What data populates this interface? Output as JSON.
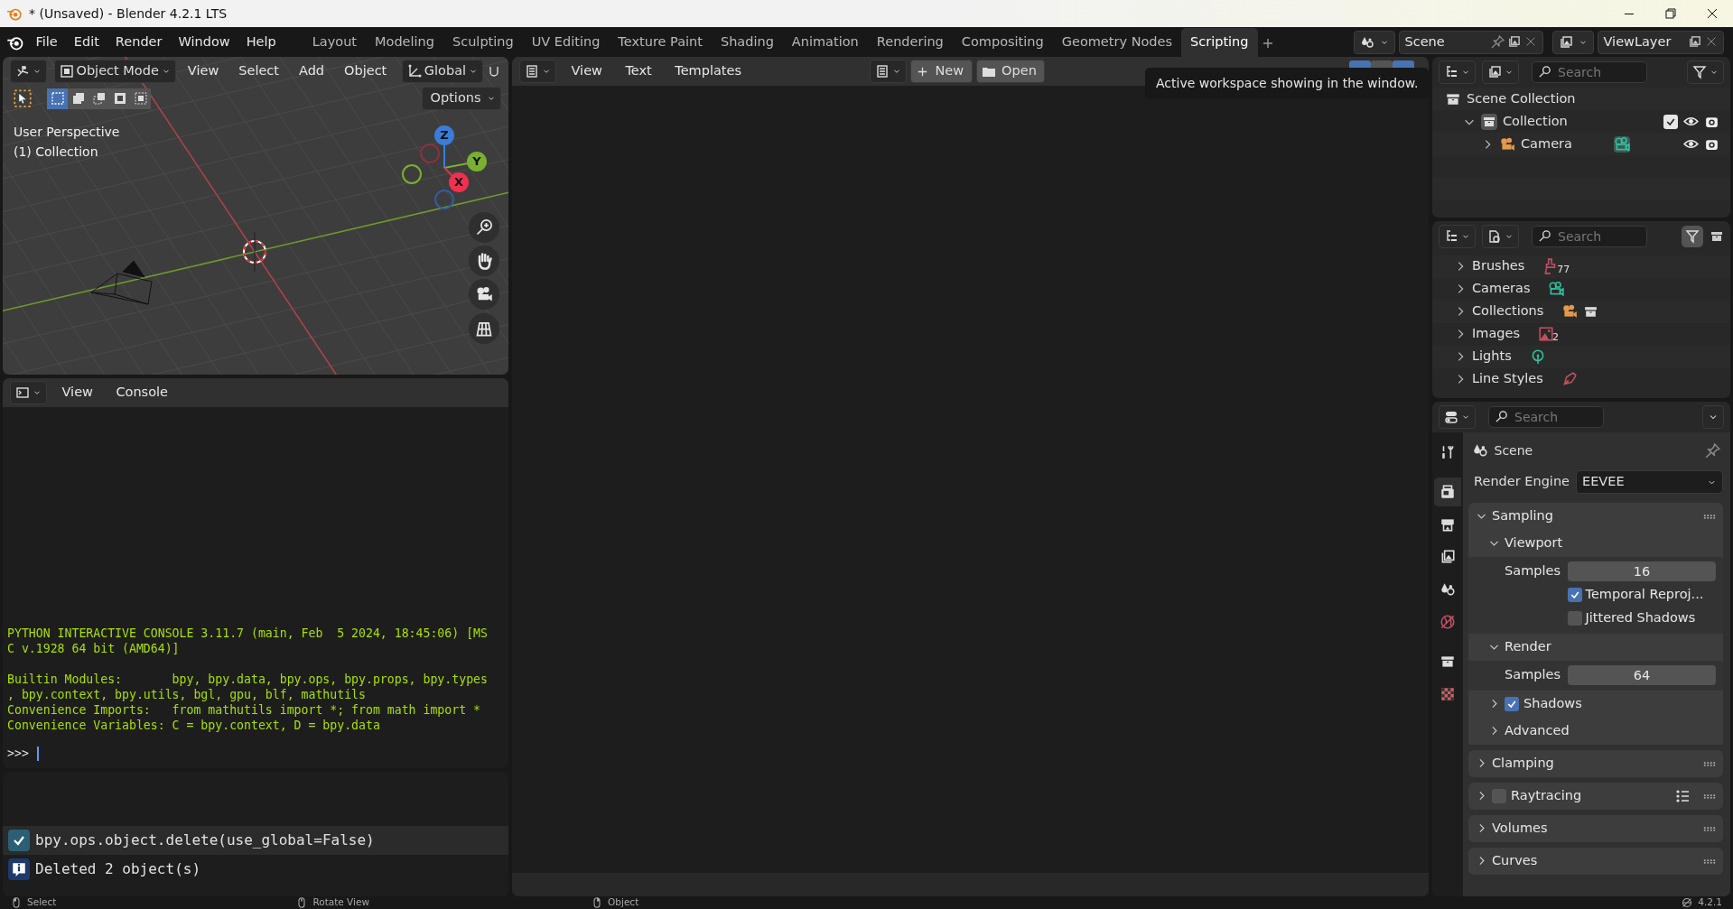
{
  "window": {
    "title": "* (Unsaved) - Blender 4.2.1 LTS"
  },
  "menu": [
    "File",
    "Edit",
    "Render",
    "Window",
    "Help"
  ],
  "workspaces": [
    {
      "label": "Layout",
      "selected": false
    },
    {
      "label": "Modeling",
      "selected": false
    },
    {
      "label": "Sculpting",
      "selected": false
    },
    {
      "label": "UV Editing",
      "selected": false
    },
    {
      "label": "Texture Paint",
      "selected": false
    },
    {
      "label": "Shading",
      "selected": false
    },
    {
      "label": "Animation",
      "selected": false
    },
    {
      "label": "Rendering",
      "selected": false
    },
    {
      "label": "Compositing",
      "selected": false
    },
    {
      "label": "Geometry Nodes",
      "selected": false
    },
    {
      "label": "Scripting",
      "selected": true
    }
  ],
  "scene": {
    "name": "Scene"
  },
  "view_layer": {
    "name": "ViewLayer"
  },
  "viewport": {
    "mode": "Object Mode",
    "menus": [
      "View",
      "Select",
      "Add",
      "Object"
    ],
    "orientation": "Global",
    "options": "Options",
    "select_modes": [
      {
        "kind": "set",
        "selected": true
      },
      {
        "kind": "extend",
        "selected": false
      },
      {
        "kind": "subtract",
        "selected": false
      },
      {
        "kind": "invert",
        "selected": false
      },
      {
        "kind": "intersect",
        "selected": false
      }
    ],
    "overlay_lines": [
      "User Perspective",
      "(1) Collection"
    ],
    "gizmo": {
      "x": "X",
      "y": "Y",
      "z": "Z"
    }
  },
  "text_editor": {
    "menus": [
      "View",
      "Text",
      "Templates"
    ],
    "new": "New",
    "open": "Open",
    "tooltip": "Active workspace showing in the window."
  },
  "console": {
    "menus": [
      "View",
      "Console"
    ],
    "blocks": [
      [
        "PYTHON INTERACTIVE CONSOLE 3.11.7 (main, Feb  5 2024, 18:45:06) [MS",
        "C v.1928 64 bit (AMD64)]"
      ],
      [
        "Builtin Modules:       bpy, bpy.data, bpy.ops, bpy.props, bpy.types",
        ", bpy.context, bpy.utils, bgl, gpu, blf, mathutils",
        "Convenience Imports:   from mathutils import *; from math import *",
        "Convenience Variables: C = bpy.context, D = bpy.data"
      ]
    ],
    "prompt": ">>>"
  },
  "info": {
    "entries": [
      {
        "kind": "operator",
        "text": "bpy.ops.object.delete(use_global=False)"
      },
      {
        "kind": "info",
        "text": "Deleted 2 object(s)"
      }
    ]
  },
  "outliner": {
    "search": {
      "placeholder": "Search"
    },
    "items": [
      {
        "label": "Scene Collection",
        "kind": "scene",
        "children": [
          {
            "label": "Collection",
            "kind": "collection",
            "expanded": true,
            "checked": true,
            "children": [
              {
                "label": "Camera",
                "kind": "camera",
                "expanded": false
              }
            ]
          }
        ]
      }
    ]
  },
  "blend_file": {
    "search": {
      "placeholder": "Search"
    },
    "items": [
      {
        "label": "Brushes",
        "kind": "brush",
        "count": "77"
      },
      {
        "label": "Cameras",
        "kind": "camera"
      },
      {
        "label": "Collections",
        "kind": "collection"
      },
      {
        "label": "Images",
        "kind": "image",
        "count": "2"
      },
      {
        "label": "Lights",
        "kind": "light"
      },
      {
        "label": "Line Styles",
        "kind": "linestyle"
      }
    ]
  },
  "properties": {
    "search": {
      "placeholder": "Search"
    },
    "tabs": [
      {
        "kind": "tool",
        "selected": false
      },
      {
        "kind": "render",
        "selected": true
      },
      {
        "kind": "output",
        "selected": false
      },
      {
        "kind": "viewlayer",
        "selected": false
      },
      {
        "kind": "scene",
        "selected": false
      },
      {
        "kind": "world",
        "selected": false
      },
      {
        "kind": "collection",
        "selected": false
      },
      {
        "kind": "texture",
        "selected": false
      }
    ],
    "context": "Scene",
    "render_engine": {
      "label": "Render Engine",
      "value": "EEVEE"
    },
    "panels": [
      {
        "label": "Sampling",
        "expanded": true,
        "children": [
          {
            "label": "Viewport",
            "expanded": true,
            "rows": [
              {
                "kind": "number",
                "label": "Samples",
                "value": "16"
              },
              {
                "kind": "checkbox",
                "label": "Temporal Reproj...",
                "checked": true
              },
              {
                "kind": "checkbox",
                "label": "Jittered Shadows",
                "checked": false
              }
            ]
          },
          {
            "label": "Render",
            "expanded": true,
            "rows": [
              {
                "kind": "number",
                "label": "Samples",
                "value": "64"
              }
            ]
          },
          {
            "label": "Shadows",
            "expanded": false,
            "checked": true
          },
          {
            "label": "Advanced",
            "expanded": false
          }
        ]
      },
      {
        "label": "Clamping",
        "expanded": false
      },
      {
        "label": "Raytracing",
        "expanded": false,
        "checked": false
      },
      {
        "label": "Volumes",
        "expanded": false
      },
      {
        "label": "Curves",
        "expanded": false
      }
    ]
  },
  "status_bar": [
    {
      "kind": "mouse-left",
      "text": "Select"
    },
    {
      "kind": "mouse-middle",
      "text": "Rotate View"
    },
    {
      "kind": "mouse-right",
      "text": "Object"
    },
    {
      "kind": "version",
      "text": "4.2.1"
    }
  ]
}
